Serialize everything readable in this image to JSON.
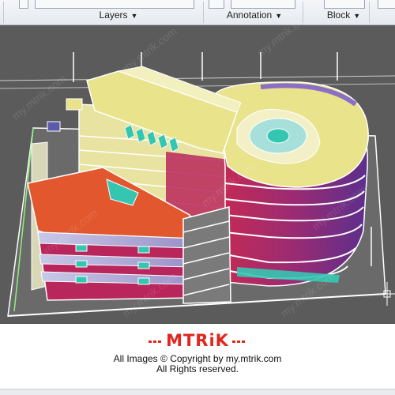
{
  "ribbon": {
    "panels": [
      {
        "label": "Layers"
      },
      {
        "label": "Annotation"
      },
      {
        "label": "Block"
      }
    ],
    "chevron": "▼"
  },
  "viewport": {
    "watermark": "my.mtrik.com",
    "colors": {
      "background": "#5b5b5b",
      "roof_yellow": "#e9e38c",
      "red_roof": "#e2572e",
      "magenta": "#b8265b",
      "purple": "#6b2f86",
      "cyan": "#35c6b2",
      "white_line": "#ffffff",
      "green_line": "#8ef07a"
    }
  },
  "branding": {
    "logo": "MTRiK",
    "copyright": "All Images © Copyright by my.mtrik.com",
    "rights": "All Rights reserved."
  }
}
